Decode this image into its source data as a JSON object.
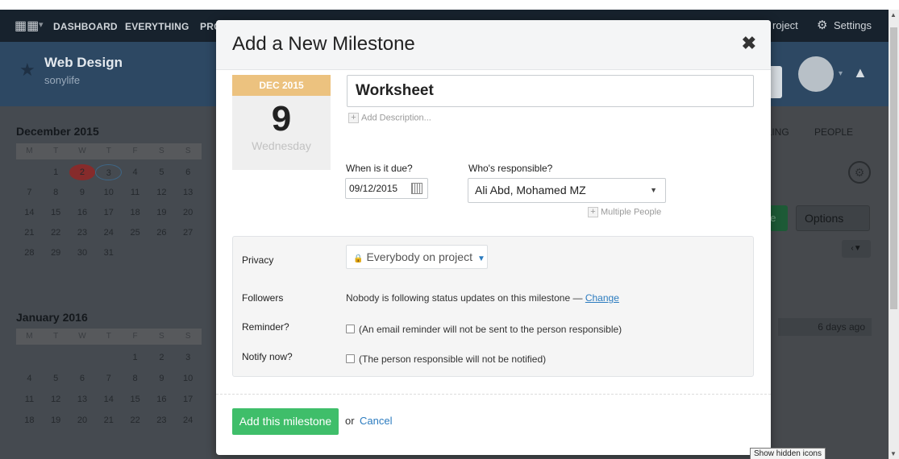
{
  "nav": {
    "items": [
      "DASHBOARD",
      "EVERYTHING",
      "PRO"
    ],
    "new_project": "roject",
    "settings": "Settings"
  },
  "project": {
    "name": "Web Design",
    "company": "sonylife"
  },
  "calendars": [
    {
      "title": "December 2015",
      "weekdays": [
        "M",
        "T",
        "W",
        "T",
        "F",
        "S",
        "S"
      ],
      "weeks": [
        [
          "",
          "1",
          "2",
          "3",
          "4",
          "5",
          "6"
        ],
        [
          "7",
          "8",
          "9",
          "10",
          "11",
          "12",
          "13"
        ],
        [
          "14",
          "15",
          "16",
          "17",
          "18",
          "19",
          "20"
        ],
        [
          "21",
          "22",
          "23",
          "24",
          "25",
          "26",
          "27"
        ],
        [
          "28",
          "29",
          "30",
          "31",
          "",
          "",
          ""
        ]
      ]
    },
    {
      "title": "January 2016",
      "weekdays": [
        "M",
        "T",
        "W",
        "T",
        "F",
        "S",
        "S"
      ],
      "weeks": [
        [
          "",
          "",
          "",
          "",
          "1",
          "2",
          "3"
        ],
        [
          "4",
          "5",
          "6",
          "7",
          "8",
          "9",
          "10"
        ],
        [
          "11",
          "12",
          "13",
          "14",
          "15",
          "16",
          "17"
        ],
        [
          "18",
          "19",
          "20",
          "21",
          "22",
          "23",
          "24"
        ]
      ]
    }
  ],
  "background": {
    "tabs": [
      "LLING",
      "PEOPLE"
    ],
    "green_button": "ne",
    "options_button": "Options",
    "ago": "6 days ago"
  },
  "modal": {
    "title": "Add a New Milestone",
    "close_symbol": "✖",
    "date_card": {
      "month": "DEC 2015",
      "day": "9",
      "weekday": "Wednesday"
    },
    "milestone_title": "Worksheet",
    "add_description": "Add Description...",
    "due_label": "When is it due?",
    "due_value": "09/12/2015",
    "responsible_label": "Who's responsible?",
    "responsible_value": "Ali Abd, Mohamed MZ",
    "multiple_people": "Multiple People",
    "privacy_label": "Privacy",
    "privacy_value": "Everybody on project",
    "followers_label": "Followers",
    "followers_text": "Nobody is following status updates on this milestone —",
    "followers_change": "Change",
    "reminder_label": "Reminder?",
    "reminder_text": "(An email reminder will not be sent to the person responsible)",
    "notify_label": "Notify now?",
    "notify_text": "(The person responsible will not be notified)",
    "submit_label": "Add this milestone",
    "or_text": "or",
    "cancel_label": "Cancel"
  },
  "tooltip": "Show hidden icons",
  "colors": {
    "accent_green": "#3fbe6a",
    "link_blue": "#2b7bbf",
    "date_header": "#ecc27f"
  }
}
